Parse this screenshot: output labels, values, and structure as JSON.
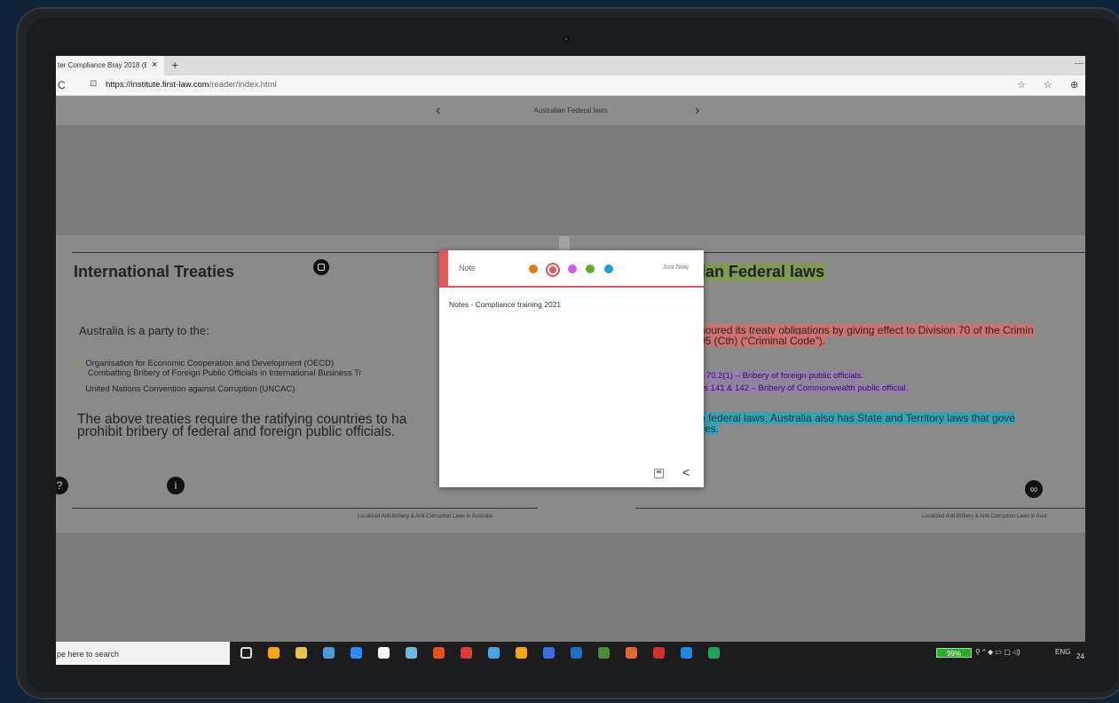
{
  "browser": {
    "tab_title": "ter Compliance Bray 2018 (E",
    "tab_close": "×",
    "new_tab": "+",
    "minimize": "—",
    "reload": "C",
    "lock": "⊡",
    "url_domain": "https://institute.first-law.com",
    "url_path": "/reader/index.html",
    "addr_icons": [
      "☆",
      "☆",
      "⊕"
    ]
  },
  "reader": {
    "title": "Australian Federal laws",
    "prev": "‹",
    "next": "›"
  },
  "left_page": {
    "heading": "International Treaties",
    "intro": "Australia is a party to the:",
    "bullets": [
      "Organisation  for  Economic  Cooperation  and  Development  (OECD)",
      "Combatting Bribery of Foreign Public Officials in International Business Tr",
      "United Nations Convention against Corruption (UNCAC)"
    ],
    "body_line1": "The  above  treaties  require  the  ratifying  countries  to  ha",
    "body_line2": "prohibit bribery of federal and foreign public officials.",
    "footer": "Localized Anti-Bribery & Anti-Corruption Laws in Australia",
    "info_icon": "i"
  },
  "right_page": {
    "heading": "ian Federal laws",
    "red_line1": "noured its treaty obligations by giving effect to Division 70 of the Crimin",
    "red_line2": "95 (Cth) (“Criminal Code”).",
    "purple_line1": "n 70.2(1) – Bribery of foreign public officials.",
    "purple_line2": "ns 141 & 142 – Bribery of Commonwealth public official.",
    "cyan_line1": "o federal laws, Australia also has State and Territory laws that gove",
    "cyan_line2": "ces.",
    "footer": "Localized Anti-Bribery & Anti-Corruption Laws in Aust"
  },
  "note": {
    "label": "Note",
    "time": "Just Now",
    "text": "Notes - Compliance training 2021",
    "colors": [
      "#e37b17",
      "#e05858",
      "#cc5ce6",
      "#5fae2f",
      "#1a9fd6"
    ],
    "selected_color": "#e05858",
    "share": "<"
  },
  "taskbar": {
    "search_text": "pe here to search",
    "battery": "99%",
    "lang": "ENG",
    "clock_partial": "24",
    "icon_colors": [
      "#ffffff",
      "#f4a712",
      "#e8c547",
      "#4b9cd6",
      "#2d8cff",
      "#ffffff",
      "#6ab7e8",
      "#e8501b",
      "#e03b3b",
      "#49a4e0",
      "#f4a712",
      "#3b6ee0",
      "#1f6ec6",
      "#4a8d3a",
      "#e06a36",
      "#d32f2f",
      "#1e88e5",
      "#1ea35a"
    ]
  }
}
